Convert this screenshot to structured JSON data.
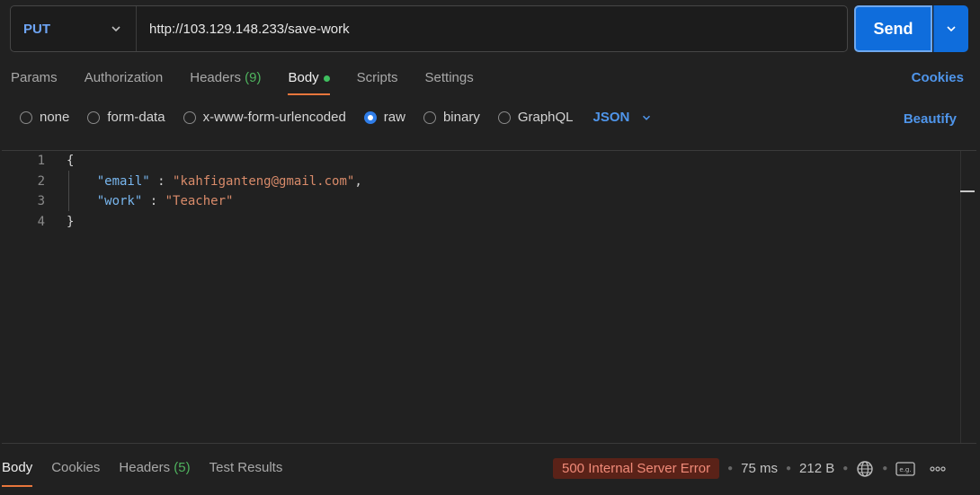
{
  "request": {
    "method": "PUT",
    "url": "http://103.129.148.233/save-work",
    "send_label": "Send"
  },
  "tabs": [
    {
      "label": "Params"
    },
    {
      "label": "Authorization"
    },
    {
      "label": "Headers",
      "count": "(9)"
    },
    {
      "label": "Body",
      "active": true
    },
    {
      "label": "Scripts"
    },
    {
      "label": "Settings"
    }
  ],
  "cookies_label": "Cookies",
  "body_types": {
    "none": "none",
    "form_data": "form-data",
    "urlencoded": "x-www-form-urlencoded",
    "raw": "raw",
    "binary": "binary",
    "graphql": "GraphQL",
    "selected": "raw",
    "format": "JSON",
    "beautify": "Beautify"
  },
  "editor": {
    "line_numbers": [
      "1",
      "2",
      "3",
      "4"
    ],
    "open_brace": "{",
    "close_brace": "}",
    "fields": [
      {
        "key": "\"email\"",
        "value": "\"kahfiganteng@gmail.com\"",
        "trailing": ","
      },
      {
        "key": "\"work\"",
        "value": "\"Teacher\"",
        "trailing": ""
      }
    ]
  },
  "response": {
    "tabs": [
      {
        "label": "Body"
      },
      {
        "label": "Cookies"
      },
      {
        "label": "Headers",
        "count": "(5)"
      },
      {
        "label": "Test Results"
      }
    ],
    "status": "500 Internal Server Error",
    "time": "75 ms",
    "size": "212 B",
    "status_color": "#f08a78"
  },
  "icons": [
    "chevron-down-icon",
    "globe-icon",
    "example-icon",
    "more-icon"
  ]
}
